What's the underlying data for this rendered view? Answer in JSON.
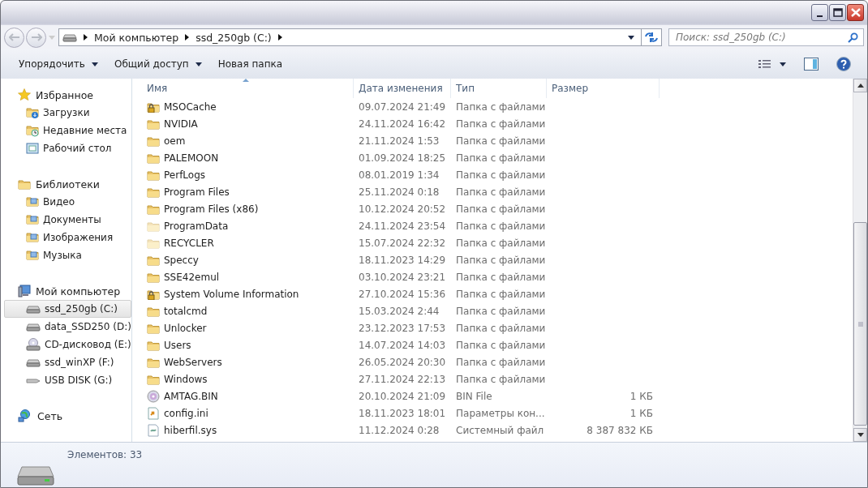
{
  "address": {
    "crumbs": [
      "Мой компьютер",
      "ssd_250gb (C:)"
    ]
  },
  "search": {
    "placeholder": "Поиск: ssd_250gb (C:)"
  },
  "toolbar": [
    {
      "label": "Упорядочить",
      "dropdown": true
    },
    {
      "label": "Общий доступ",
      "dropdown": true
    },
    {
      "label": "Новая папка",
      "dropdown": false
    }
  ],
  "sidebar": {
    "groups": [
      {
        "label": "Избранное",
        "kind": "star",
        "children": [
          {
            "label": "Загрузки",
            "kind": "downloads",
            "selected": false
          },
          {
            "label": "Недавние места",
            "kind": "recent",
            "selected": false
          },
          {
            "label": "Рабочий стол",
            "kind": "desktop",
            "selected": false
          }
        ]
      },
      {
        "label": "Библиотеки",
        "kind": "library",
        "children": [
          {
            "label": "Видео",
            "kind": "lib-item",
            "selected": false
          },
          {
            "label": "Документы",
            "kind": "lib-item",
            "selected": false
          },
          {
            "label": "Изображения",
            "kind": "lib-item",
            "selected": false
          },
          {
            "label": "Музыка",
            "kind": "lib-item",
            "selected": false
          }
        ]
      },
      {
        "label": "Мой компьютер",
        "kind": "computer",
        "children": [
          {
            "label": "ssd_250gb (C:)",
            "kind": "drive",
            "selected": true
          },
          {
            "label": "data_SSD250 (D:)",
            "kind": "drive",
            "selected": false
          },
          {
            "label": "CD-дисковод (E:)",
            "kind": "cd",
            "selected": false
          },
          {
            "label": "ssd_winXP (F:)",
            "kind": "drive",
            "selected": false
          },
          {
            "label": "USB DISK (G:)",
            "kind": "usb",
            "selected": false
          }
        ]
      },
      {
        "label": "Сеть",
        "kind": "network"
      }
    ]
  },
  "table": {
    "columns": [
      {
        "label": "Имя",
        "sorted": true
      },
      {
        "label": "Дата изменения",
        "sorted": false
      },
      {
        "label": "Тип",
        "sorted": false
      },
      {
        "label": "Размер",
        "sorted": false
      }
    ],
    "rows": [
      {
        "name": "MSOCache",
        "date": "09.07.2024 21:49",
        "type": "Папка с файлами",
        "kind": "locked-folder",
        "hidden": false
      },
      {
        "name": "NVIDIA",
        "date": "24.11.2024 16:42",
        "type": "Папка с файлами",
        "kind": "folder",
        "hidden": false
      },
      {
        "name": "oem",
        "date": "21.11.2024 1:53",
        "type": "Папка с файлами",
        "kind": "folder",
        "hidden": false
      },
      {
        "name": "PALEMOON",
        "date": "01.09.2024 18:25",
        "type": "Папка с файлами",
        "kind": "folder",
        "hidden": false
      },
      {
        "name": "PerfLogs",
        "date": "08.01.2019 1:34",
        "type": "Папка с файлами",
        "kind": "folder",
        "hidden": false
      },
      {
        "name": "Program Files",
        "date": "25.11.2024 0:18",
        "type": "Папка с файлами",
        "kind": "folder",
        "hidden": false
      },
      {
        "name": "Program Files (x86)",
        "date": "10.12.2024 20:52",
        "type": "Папка с файлами",
        "kind": "folder",
        "hidden": false
      },
      {
        "name": "ProgramData",
        "date": "24.11.2024 23:54",
        "type": "Папка с файлами",
        "kind": "folder",
        "hidden": true
      },
      {
        "name": "RECYCLER",
        "date": "15.07.2024 22:32",
        "type": "Папка с файлами",
        "kind": "folder",
        "hidden": true
      },
      {
        "name": "Speccy",
        "date": "18.11.2023 14:29",
        "type": "Папка с файлами",
        "kind": "folder",
        "hidden": false
      },
      {
        "name": "SSE42emul",
        "date": "03.10.2024 23:21",
        "type": "Папка с файлами",
        "kind": "folder",
        "hidden": false
      },
      {
        "name": "System Volume Information",
        "date": "27.10.2024 15:36",
        "type": "Папка с файлами",
        "kind": "locked-folder",
        "hidden": false
      },
      {
        "name": "totalcmd",
        "date": "15.03.2024 2:44",
        "type": "Папка с файлами",
        "kind": "folder",
        "hidden": false
      },
      {
        "name": "Unlocker",
        "date": "23.12.2023 17:53",
        "type": "Папка с файлами",
        "kind": "folder",
        "hidden": false
      },
      {
        "name": "Users",
        "date": "14.07.2024 14:03",
        "type": "Папка с файлами",
        "kind": "folder",
        "hidden": false
      },
      {
        "name": "WebServers",
        "date": "26.05.2024 20:30",
        "type": "Папка с файлами",
        "kind": "folder",
        "hidden": false
      },
      {
        "name": "Windows",
        "date": "27.11.2024 22:13",
        "type": "Папка с файлами",
        "kind": "folder",
        "hidden": false
      },
      {
        "name": "AMTAG.BIN",
        "date": "20.10.2024 21:09",
        "type": "BIN File",
        "size": "1 КБ",
        "kind": "disc-file",
        "hidden": false
      },
      {
        "name": "config.ini",
        "date": "18.11.2023 18:01",
        "type": "Параметры кон...",
        "size": "1 КБ",
        "kind": "settings-file",
        "hidden": false
      },
      {
        "name": "hiberfil.sys",
        "date": "11.12.2024 0:28",
        "type": "Системный файл",
        "size": "8 387 832 КБ",
        "kind": "system-file",
        "hidden": false
      }
    ]
  },
  "status_bar": {
    "text": "Элементов: 33"
  }
}
